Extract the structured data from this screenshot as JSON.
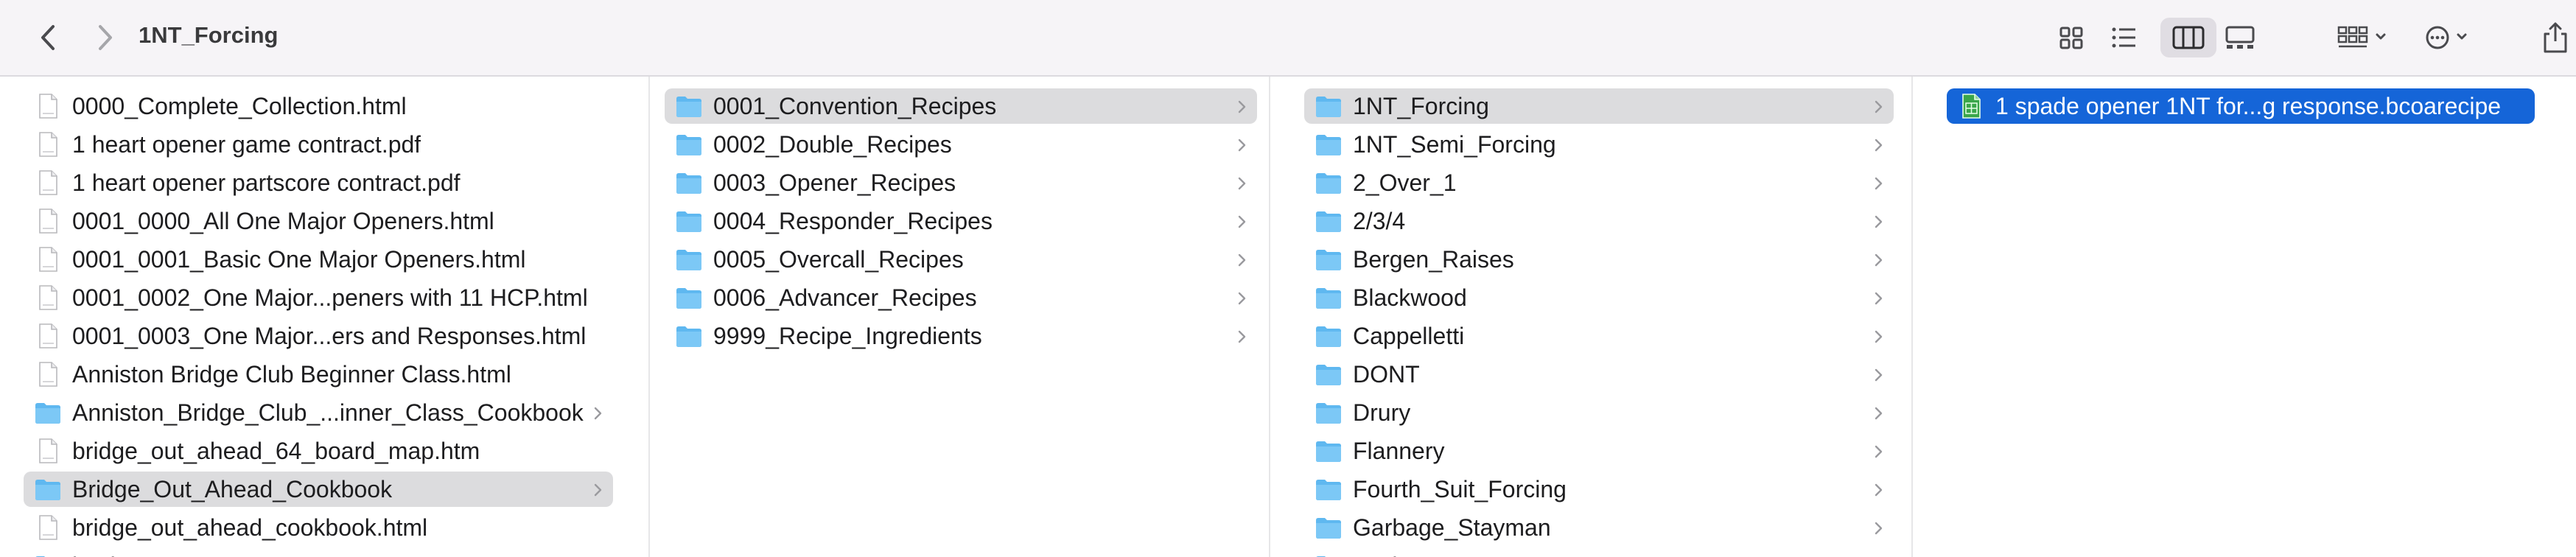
{
  "window": {
    "title": "1NT_Forcing"
  },
  "toolbar": {
    "icons": [
      "chevron-left-icon",
      "chevron-right-icon",
      "icon-view-icon",
      "list-view-icon",
      "column-view-icon",
      "gallery-view-icon",
      "group-icon",
      "more-icon",
      "share-icon"
    ],
    "active_view": "column"
  },
  "columns": [
    {
      "items": [
        {
          "label": "0000_Complete_Collection.html",
          "type": "file"
        },
        {
          "label": "1 heart opener game contract.pdf",
          "type": "file"
        },
        {
          "label": "1 heart opener partscore contract.pdf",
          "type": "file"
        },
        {
          "label": "0001_0000_All One Major Openers.html",
          "type": "file"
        },
        {
          "label": "0001_0001_Basic One Major Openers.html",
          "type": "file"
        },
        {
          "label": "0001_0002_One Major...peners with 11 HCP.html",
          "type": "file"
        },
        {
          "label": "0001_0003_One Major...ers and Responses.html",
          "type": "file"
        },
        {
          "label": "Anniston Bridge Club Beginner Class.html",
          "type": "file"
        },
        {
          "label": "Anniston_Bridge_Club_...inner_Class_Cookbook",
          "type": "folder"
        },
        {
          "label": "bridge_out_ahead_64_board_map.htm",
          "type": "file"
        },
        {
          "label": "Bridge_Out_Ahead_Cookbook",
          "type": "folder",
          "selected": true
        },
        {
          "label": "bridge_out_ahead_cookbook.html",
          "type": "file"
        },
        {
          "label": "bucket",
          "type": "folder"
        }
      ]
    },
    {
      "items": [
        {
          "label": "0001_Convention_Recipes",
          "type": "folder",
          "selected": true
        },
        {
          "label": "0002_Double_Recipes",
          "type": "folder"
        },
        {
          "label": "0003_Opener_Recipes",
          "type": "folder"
        },
        {
          "label": "0004_Responder_Recipes",
          "type": "folder"
        },
        {
          "label": "0005_Overcall_Recipes",
          "type": "folder"
        },
        {
          "label": "0006_Advancer_Recipes",
          "type": "folder"
        },
        {
          "label": "9999_Recipe_Ingredients",
          "type": "folder"
        }
      ]
    },
    {
      "items": [
        {
          "label": "1NT_Forcing",
          "type": "folder",
          "selected": true
        },
        {
          "label": "1NT_Semi_Forcing",
          "type": "folder"
        },
        {
          "label": "2_Over_1",
          "type": "folder"
        },
        {
          "label": "2/3/4",
          "type": "folder"
        },
        {
          "label": "Bergen_Raises",
          "type": "folder"
        },
        {
          "label": "Blackwood",
          "type": "folder"
        },
        {
          "label": "Cappelletti",
          "type": "folder"
        },
        {
          "label": "DONT",
          "type": "folder"
        },
        {
          "label": "Drury",
          "type": "folder"
        },
        {
          "label": "Flannery",
          "type": "folder"
        },
        {
          "label": "Fourth_Suit_Forcing",
          "type": "folder"
        },
        {
          "label": "Garbage_Stayman",
          "type": "folder"
        },
        {
          "label": "Gerber",
          "type": "folder"
        }
      ]
    },
    {
      "items": [
        {
          "label": "1 spade opener 1NT for...g response.bcoarecipe",
          "type": "recipe",
          "selected": true
        }
      ]
    }
  ],
  "colors": {
    "folder": "#5fb8f0",
    "selection_gray": "#dcdcde",
    "selection_blue": "#1565d8",
    "toolbar_bg": "#f6f4f7"
  }
}
